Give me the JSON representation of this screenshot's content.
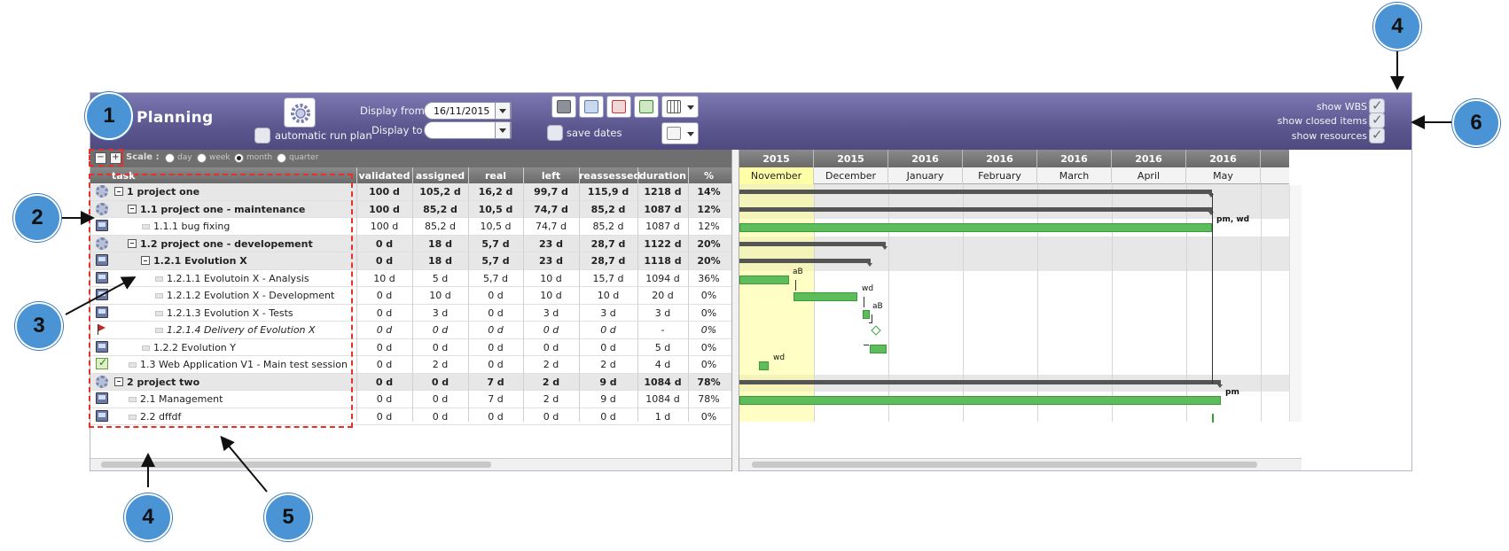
{
  "header": {
    "title": "Planning",
    "auto_run_label": "automatic run plan",
    "display_from_label": "Display from",
    "display_from_value": "16/11/2015",
    "display_to_label": "Display to",
    "display_to_value": "",
    "save_dates_label": "save dates",
    "options": [
      {
        "label": "show WBS",
        "checked": true
      },
      {
        "label": "show closed items",
        "checked": true
      },
      {
        "label": "show resources",
        "checked": true
      }
    ]
  },
  "toolbar": {
    "icons": [
      "save-icon",
      "print-icon",
      "pdf-icon",
      "project-export-icon",
      "columns-icon",
      "new-document-icon"
    ]
  },
  "scale": {
    "label": "Scale :",
    "options": [
      "day",
      "week",
      "month",
      "quarter"
    ],
    "selected": "month"
  },
  "columns": [
    "task",
    "validated",
    "assigned",
    "real",
    "left",
    "reassessed",
    "duration",
    "%"
  ],
  "rows": [
    {
      "icon": "gear-icon",
      "level": 0,
      "toggle": true,
      "parent": true,
      "italic": false,
      "name": "1 project one",
      "validated": "100 d",
      "assigned": "105,2 d",
      "real": "16,2 d",
      "left": "99,7 d",
      "reassessed": "115,9 d",
      "duration": "1218 d",
      "pct": "14%"
    },
    {
      "icon": "gear-icon",
      "level": 1,
      "toggle": true,
      "parent": true,
      "italic": false,
      "name": "1.1 project one - maintenance",
      "validated": "100 d",
      "assigned": "85,2 d",
      "real": "10,5 d",
      "left": "74,7 d",
      "reassessed": "85,2 d",
      "duration": "1087 d",
      "pct": "12%"
    },
    {
      "icon": "computer-icon",
      "level": 2,
      "toggle": false,
      "parent": false,
      "italic": false,
      "name": "1.1.1 bug fixing",
      "validated": "100 d",
      "assigned": "85,2 d",
      "real": "10,5 d",
      "left": "74,7 d",
      "reassessed": "85,2 d",
      "duration": "1087 d",
      "pct": "12%"
    },
    {
      "icon": "gear-icon",
      "level": 1,
      "toggle": true,
      "parent": true,
      "italic": false,
      "name": "1.2 project one - developement",
      "validated": "0 d",
      "assigned": "18 d",
      "real": "5,7 d",
      "left": "23 d",
      "reassessed": "28,7 d",
      "duration": "1122 d",
      "pct": "20%"
    },
    {
      "icon": "computer-icon",
      "level": 2,
      "toggle": true,
      "parent": true,
      "italic": false,
      "name": "1.2.1 Evolution X",
      "validated": "0 d",
      "assigned": "18 d",
      "real": "5,7 d",
      "left": "23 d",
      "reassessed": "28,7 d",
      "duration": "1118 d",
      "pct": "20%"
    },
    {
      "icon": "computer-icon",
      "level": 3,
      "toggle": false,
      "parent": false,
      "italic": false,
      "name": "1.2.1.1 Evolutoin X - Analysis",
      "validated": "10 d",
      "assigned": "5 d",
      "real": "5,7 d",
      "left": "10 d",
      "reassessed": "15,7 d",
      "duration": "1094 d",
      "pct": "36%"
    },
    {
      "icon": "computer-icon",
      "level": 3,
      "toggle": false,
      "parent": false,
      "italic": false,
      "name": "1.2.1.2 Evolution X - Development",
      "validated": "0 d",
      "assigned": "10 d",
      "real": "0 d",
      "left": "10 d",
      "reassessed": "10 d",
      "duration": "20 d",
      "pct": "0%"
    },
    {
      "icon": "computer-icon",
      "level": 3,
      "toggle": false,
      "parent": false,
      "italic": false,
      "name": "1.2.1.3 Evolution X - Tests",
      "validated": "0 d",
      "assigned": "3 d",
      "real": "0 d",
      "left": "3 d",
      "reassessed": "3 d",
      "duration": "3 d",
      "pct": "0%"
    },
    {
      "icon": "flag-icon",
      "level": 3,
      "toggle": false,
      "parent": false,
      "italic": true,
      "name": "1.2.1.4 Delivery of Evolution X",
      "validated": "0 d",
      "assigned": "0 d",
      "real": "0 d",
      "left": "0 d",
      "reassessed": "0 d",
      "duration": "-",
      "pct": "0%"
    },
    {
      "icon": "computer-icon",
      "level": 2,
      "toggle": false,
      "parent": false,
      "italic": false,
      "name": "1.2.2 Evolution Y",
      "validated": "0 d",
      "assigned": "0 d",
      "real": "0 d",
      "left": "0 d",
      "reassessed": "0 d",
      "duration": "5 d",
      "pct": "0%"
    },
    {
      "icon": "test-session-icon",
      "level": 1,
      "toggle": false,
      "parent": false,
      "italic": false,
      "name": "1.3 Web Application V1 - Main test session",
      "validated": "0 d",
      "assigned": "2 d",
      "real": "0 d",
      "left": "2 d",
      "reassessed": "2 d",
      "duration": "4 d",
      "pct": "0%"
    },
    {
      "icon": "gear-icon",
      "level": 0,
      "toggle": true,
      "parent": true,
      "italic": false,
      "name": "2 project two",
      "validated": "0 d",
      "assigned": "0 d",
      "real": "7 d",
      "left": "2 d",
      "reassessed": "9 d",
      "duration": "1084 d",
      "pct": "78%"
    },
    {
      "icon": "computer-icon",
      "level": 1,
      "toggle": false,
      "parent": false,
      "italic": false,
      "name": "2.1 Management",
      "validated": "0 d",
      "assigned": "0 d",
      "real": "7 d",
      "left": "2 d",
      "reassessed": "9 d",
      "duration": "1084 d",
      "pct": "78%"
    },
    {
      "icon": "computer-icon",
      "level": 1,
      "toggle": false,
      "parent": false,
      "italic": false,
      "name": "2.2 dffdf",
      "validated": "0 d",
      "assigned": "0 d",
      "real": "0 d",
      "left": "0 d",
      "reassessed": "0 d",
      "duration": "1 d",
      "pct": "0%"
    }
  ],
  "gantt": {
    "years": [
      "2015",
      "2015",
      "2016",
      "2016",
      "2016",
      "2016",
      "2016"
    ],
    "months": [
      "November",
      "December",
      "January",
      "February",
      "March",
      "April",
      "May"
    ],
    "current_month": "November",
    "bar_labels": [
      {
        "row": 2,
        "text": "pm, wd"
      },
      {
        "row": 5,
        "text": "aB"
      },
      {
        "row": 6,
        "text": "wd"
      },
      {
        "row": 7,
        "text": "aB"
      },
      {
        "row": 10,
        "text": "wd"
      },
      {
        "row": 12,
        "text": "pm"
      }
    ]
  },
  "annotations": {
    "badges": [
      "1",
      "2",
      "3",
      "4",
      "5",
      "4",
      "6"
    ]
  },
  "colors": {
    "header_bg": "#5c578f",
    "bar_green": "#5cbd5a",
    "summary_bar": "#555555",
    "current_month": "#ffffa8",
    "badge_blue": "#4a94d6",
    "highlight_red": "#e8302a"
  }
}
